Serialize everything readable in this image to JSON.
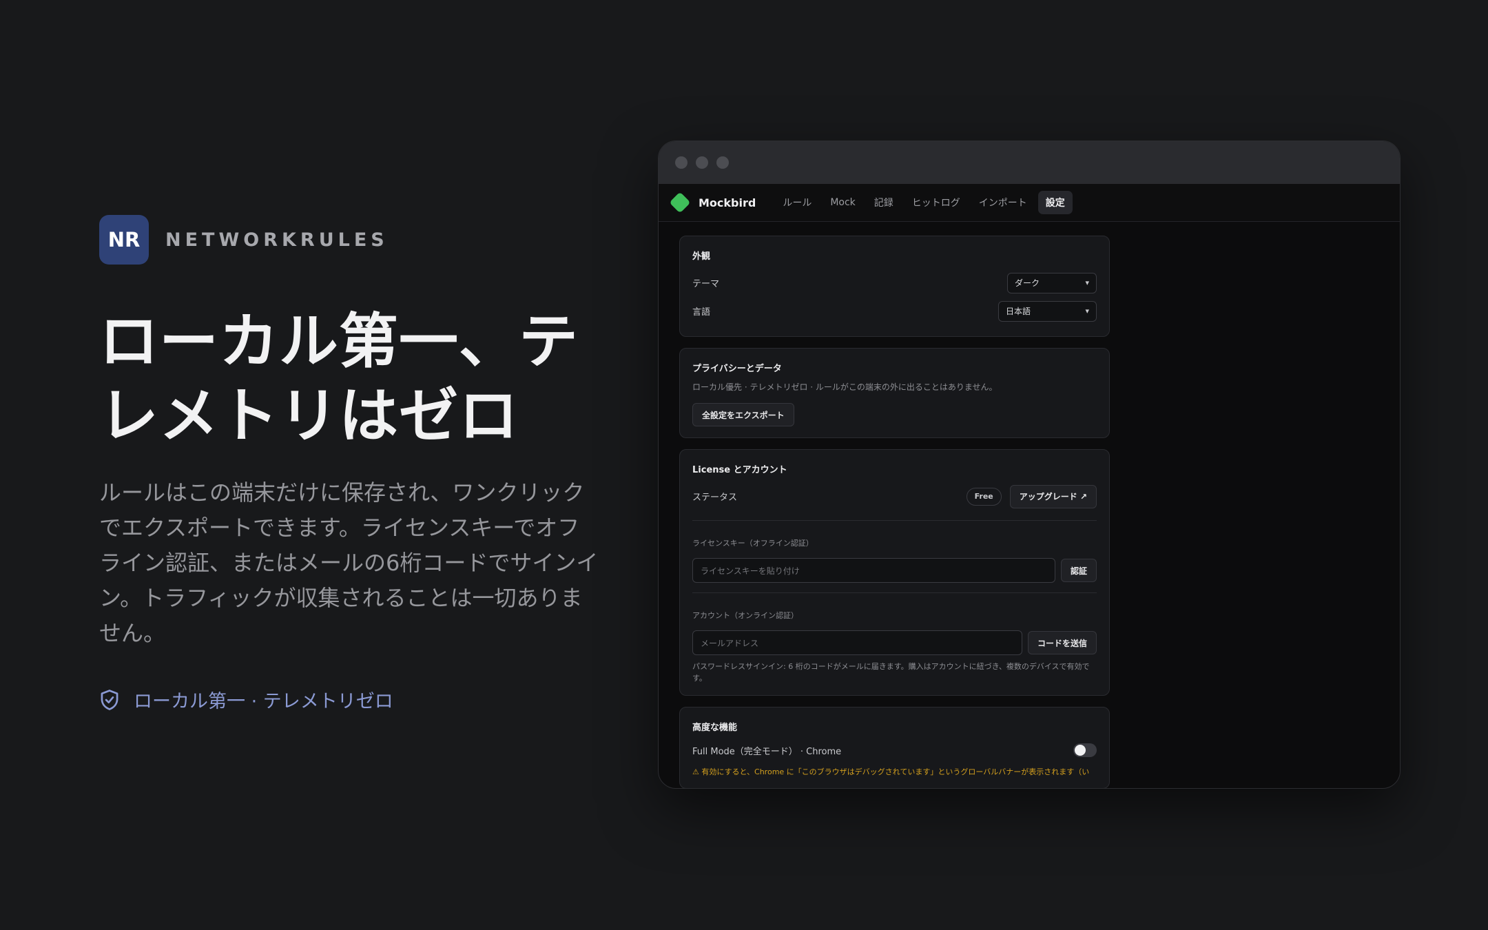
{
  "brand": {
    "logo_text": "NR",
    "name": "NETWORKRULES"
  },
  "headline": {
    "line1": "ローカル第一、テ",
    "line2": "レメトリはゼロ"
  },
  "lede": {
    "lines": [
      "ルールはこの端末だけに保存され、ワンクリック",
      "でエクスポートできます。ライセンスキーでオフ",
      "ライン認証、またはメールの6桁コードでサインイ",
      "ン。トラフィックが収集されることは一切ありま",
      "せん。"
    ]
  },
  "badge": {
    "icon": "shield-check-icon",
    "text": "ローカル第一 · テレメトリゼロ"
  },
  "app": {
    "name": "Mockbird",
    "logo_color": "#3fbf5a",
    "tabs": [
      {
        "label": "ルール"
      },
      {
        "label": "Mock"
      },
      {
        "label": "記録"
      },
      {
        "label": "ヒットログ"
      },
      {
        "label": "インポート"
      },
      {
        "label": "設定",
        "active": true
      }
    ]
  },
  "appearance": {
    "title": "外観",
    "theme_label": "テーマ",
    "theme_value": "ダーク",
    "language_label": "言語",
    "language_value": "日本語"
  },
  "privacy": {
    "title": "プライバシーとデータ",
    "description": "ローカル優先 · テレメトリゼロ · ルールがこの端末の外に出ることはありません。",
    "export_button": "全設定をエクスポート"
  },
  "license": {
    "title": "License とアカウント",
    "status_label": "ステータス",
    "status_value": "Free",
    "upgrade_button": "アップグレード ↗",
    "license_key_label": "ライセンスキー（オフライン認証）",
    "license_key_placeholder": "ライセンスキーを貼り付け",
    "verify_button": "認証",
    "account_label": "アカウント（オンライン認証）",
    "email_placeholder": "メールアドレス",
    "send_code_button": "コードを送信",
    "note_line1": "パスワードレスサインイン: 6 桁のコードがメールに届きます。購入はアカウントに紐づき、複数のデバイスで有効で",
    "note_line2": "す。"
  },
  "advanced": {
    "title": "高度な機能",
    "full_mode_label": "Full Mode（完全モード） · Chrome",
    "full_mode_enabled": false,
    "warning": "⚠ 有効にすると、Chrome に「このブラウザはデバッグされています」というグローバルバナーが表示されます（い"
  },
  "colors": {
    "background": "#18191b",
    "accent_badge": "#8b9ad4",
    "logo_bg": "#2f4277",
    "warning": "#d4a01e"
  }
}
